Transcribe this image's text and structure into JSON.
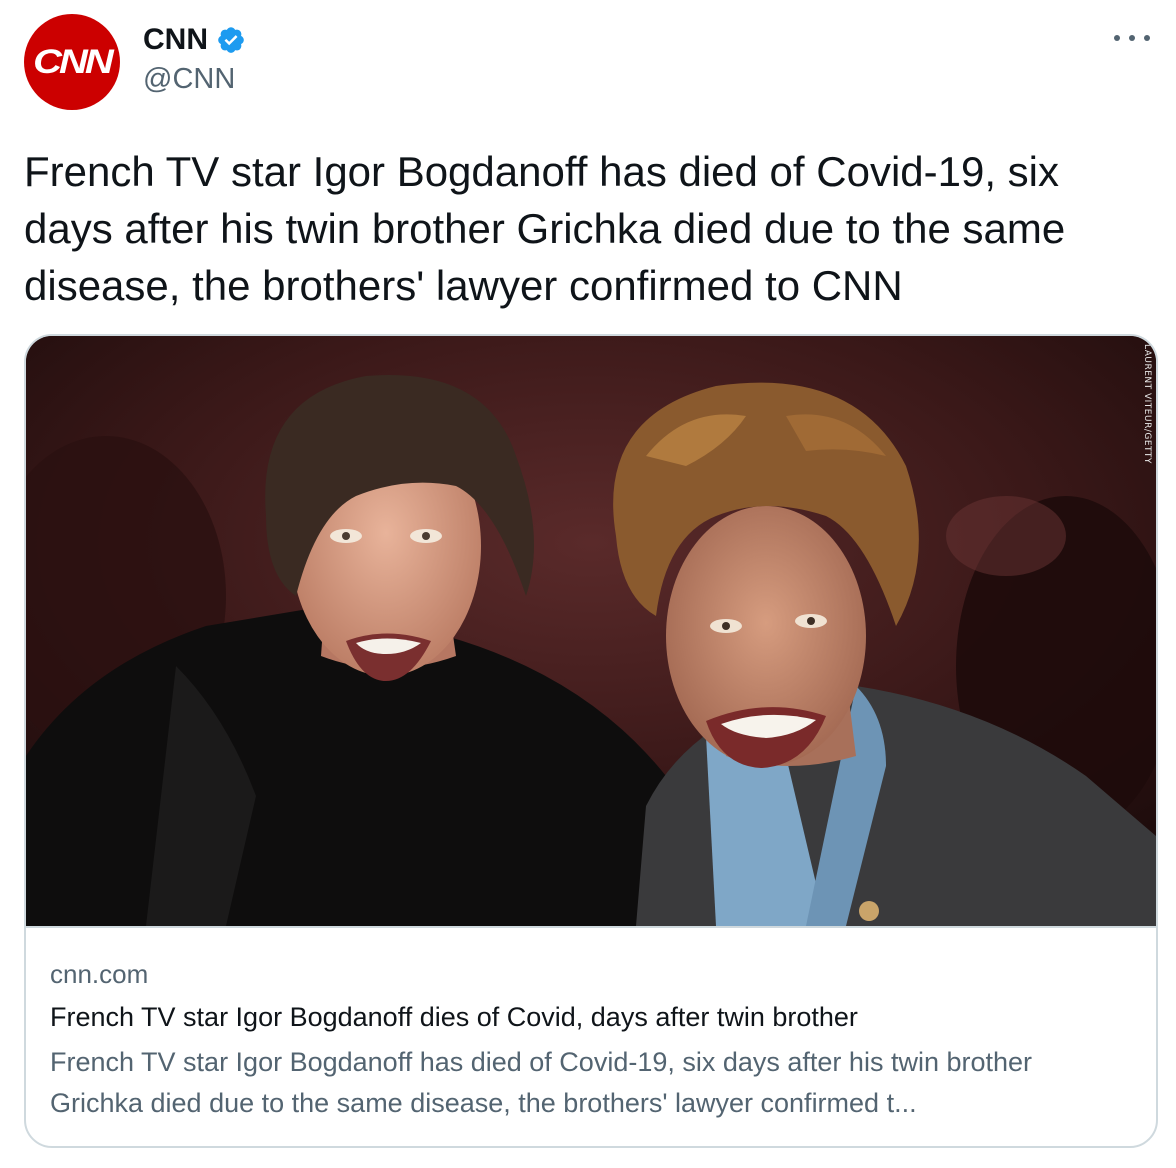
{
  "author": {
    "display_name": "CNN",
    "handle": "@CNN",
    "avatar_icon": "cnn-logo-icon",
    "avatar_text": "CNN",
    "avatar_color": "#cc0000",
    "verified": true,
    "verified_icon": "verified-badge-icon",
    "verified_color": "#1d9bf0"
  },
  "more_icon": "more-options-icon",
  "tweet": {
    "text": "French TV star Igor Bogdanoff has died of Covid-19, six days after his twin brother Grichka died due to the same disease, the brothers' lawyer confirmed to CNN"
  },
  "card": {
    "image_alt": "twin-brothers-photo",
    "photo_credit": "LAURENT VITEUR/GETTY",
    "domain": "cnn.com",
    "title": "French TV star Igor Bogdanoff dies of Covid, days after twin brother",
    "description": "French TV star Igor Bogdanoff has died of Covid-19, six days after his twin brother Grichka died due to the same disease, the brothers' lawyer confirmed t..."
  },
  "colors": {
    "text_primary": "#0f1419",
    "text_secondary": "#536471",
    "border": "#cfd9de"
  }
}
